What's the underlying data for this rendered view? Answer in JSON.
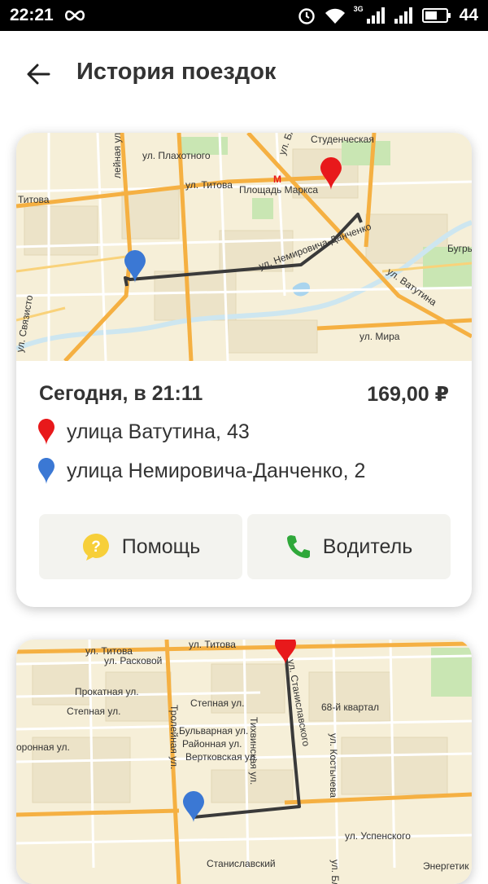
{
  "status_bar": {
    "time": "22:21",
    "network_label": "3G",
    "battery": "44"
  },
  "header": {
    "title": "История поездок"
  },
  "trips": [
    {
      "date": "Сегодня, в 21:11",
      "price": "169,00 ₽",
      "address_from": "улица Ватутина, 43",
      "address_to": "улица Немировича-Данченко, 2",
      "help_label": "Помощь",
      "driver_label": "Водитель",
      "map_labels": {
        "plakhotnogo": "ул. Плахотного",
        "titova": "ул. Титова",
        "titova_left": "Титова",
        "studencheskaya": "Студенческая",
        "ploschad_marksa": "Площадь Маркса",
        "nemirovicha": "ул. Немировича-Данченко",
        "vatutina": "ул. Ватутина",
        "mira": "ул. Мира",
        "bugry": "Бугры",
        "svyazistov": "ул. Связисто",
        "troleinaya": "лейная ул.",
        "metro": "М",
        "bl": "ул. Бл"
      }
    },
    {
      "map_labels": {
        "titova1": "ул. Титова",
        "titova2": "ул. Титова",
        "raskovoi": "ул. Расковой",
        "prokhatnaya": "Прокатная ул.",
        "stepnaya": "Степная ул.",
        "stepnaya2": "Степная ул.",
        "oronnaya": "оронная ул.",
        "troleinaya": "Тролейная ул.",
        "tikhvinskaya": "Тихвинская ул.",
        "bulvarnaya": "Бульварная ул.",
        "raionnaya": "Районная ул.",
        "vertkovskaya": "Вертковская ул.",
        "stanislavskogo": "ул. Станиславского",
        "kvartal": "68-й квартал",
        "kostycheva": "ул. Костычева",
        "uspenskogo": "ул. Успенского",
        "stanislavsky": "Станиславский",
        "energetik": "Энергетик",
        "bl": "ул. Бло"
      }
    }
  ],
  "colors": {
    "accent_red": "#e8191b",
    "accent_blue": "#3b78d4",
    "help_yellow": "#f7cf3a",
    "phone_green": "#2fa83a",
    "map_bg": "#f6efd8"
  }
}
